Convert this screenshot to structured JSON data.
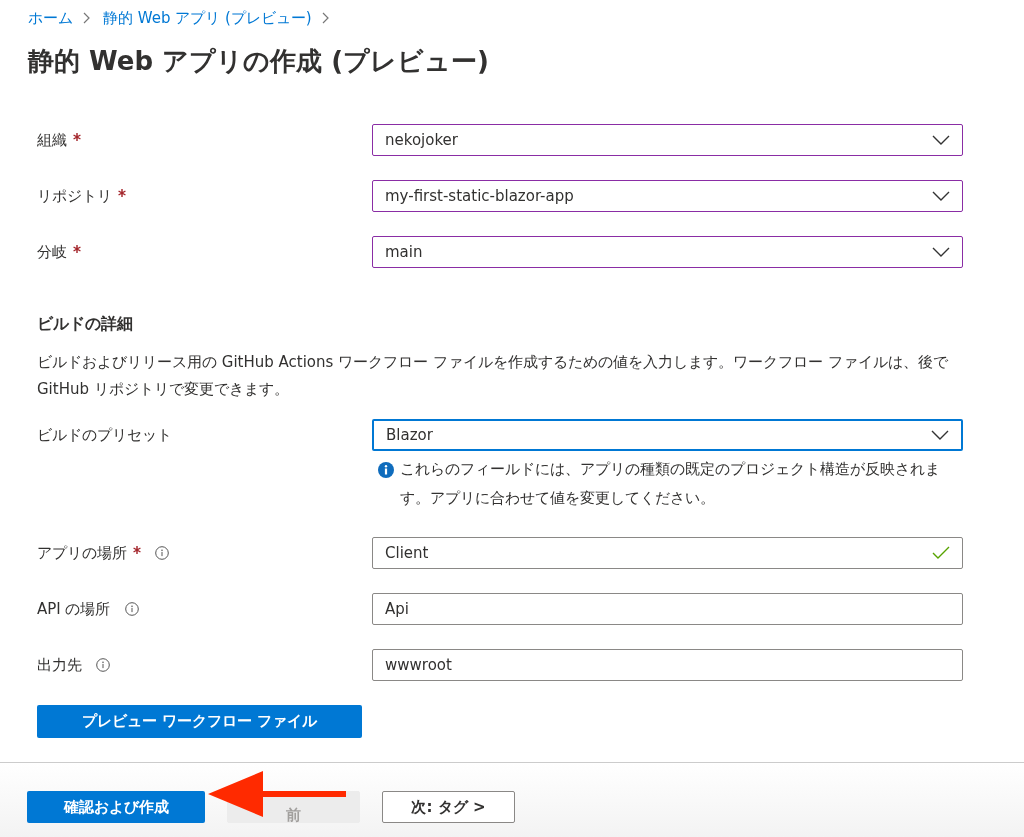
{
  "breadcrumb": [
    {
      "label": "ホーム"
    },
    {
      "label": "静的 Web アプリ (プレビュー)"
    }
  ],
  "title": "静的 Web アプリの作成 (プレビュー)",
  "source_fields": [
    {
      "label": "組織",
      "required": true,
      "kind": "dropdown",
      "value": "nekojoker",
      "edited": true
    },
    {
      "label": "リポジトリ",
      "required": true,
      "kind": "dropdown",
      "value": "my-first-static-blazor-app",
      "edited": true
    },
    {
      "label": "分岐",
      "required": true,
      "kind": "dropdown",
      "value": "main",
      "edited": true
    }
  ],
  "build_details": {
    "heading": "ビルドの詳細",
    "description": "ビルドおよびリリース用の GitHub Actions ワークフロー ファイルを作成するための値を入力します。ワークフロー ファイルは、後で GitHub リポジトリで変更できます。",
    "preset": {
      "label": "ビルドのプリセット",
      "kind": "dropdown",
      "value": "Blazor",
      "focused": true
    },
    "note": "これらのフィールドには、アプリの種類の既定のプロジェクト構造が反映されます。アプリに合わせて値を変更してください。",
    "fields": [
      {
        "label": "アプリの場所",
        "required": true,
        "info": true,
        "kind": "text",
        "value": "Client",
        "valid": true
      },
      {
        "label": "API の場所",
        "required": false,
        "info": true,
        "kind": "text",
        "value": "Api",
        "valid": false
      },
      {
        "label": "出力先",
        "required": false,
        "info": true,
        "kind": "text",
        "value": "wwwroot",
        "valid": false
      }
    ],
    "preview_button": "プレビュー ワークフロー ファイル"
  },
  "footer": [
    {
      "label": "確認および作成",
      "kind": "primary",
      "disabled": false
    },
    {
      "label": "前",
      "kind": "secondary",
      "disabled": true
    },
    {
      "label": "次: タグ >",
      "kind": "secondary",
      "disabled": false
    }
  ]
}
